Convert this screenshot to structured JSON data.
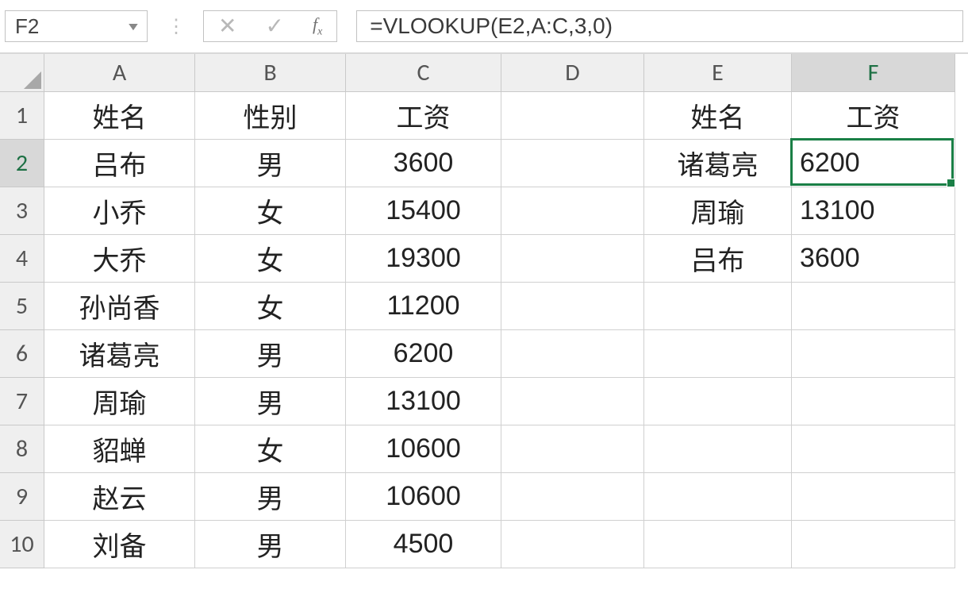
{
  "nameBox": "F2",
  "formula": "=VLOOKUP(E2,A:C,3,0)",
  "columns": [
    "A",
    "B",
    "C",
    "D",
    "E",
    "F"
  ],
  "rowCount": 10,
  "selection": {
    "col": 5,
    "row": 1
  },
  "cells": {
    "A1": "姓名",
    "B1": "性别",
    "C1": "工资",
    "E1": "姓名",
    "F1": "工资",
    "A2": "吕布",
    "B2": "男",
    "C2": "3600",
    "E2": "诸葛亮",
    "F2": "6200",
    "A3": "小乔",
    "B3": "女",
    "C3": "15400",
    "E3": "周瑜",
    "F3": "13100",
    "A4": "大乔",
    "B4": "女",
    "C4": "19300",
    "E4": "吕布",
    "F4": "3600",
    "A5": "孙尚香",
    "B5": "女",
    "C5": "11200",
    "A6": "诸葛亮",
    "B6": "男",
    "C6": "6200",
    "A7": "周瑜",
    "B7": "男",
    "C7": "13100",
    "A8": "貂蝉",
    "B8": "女",
    "C8": "10600",
    "A9": "赵云",
    "B9": "男",
    "C9": "10600",
    "A10": "刘备",
    "B10": "男",
    "C10": "4500"
  },
  "alignment": {
    "defaultCenterCols": [
      "A",
      "B",
      "C",
      "E"
    ],
    "leftCells": [
      "F2",
      "F3",
      "F4"
    ],
    "centerCells": [
      "F1"
    ]
  }
}
